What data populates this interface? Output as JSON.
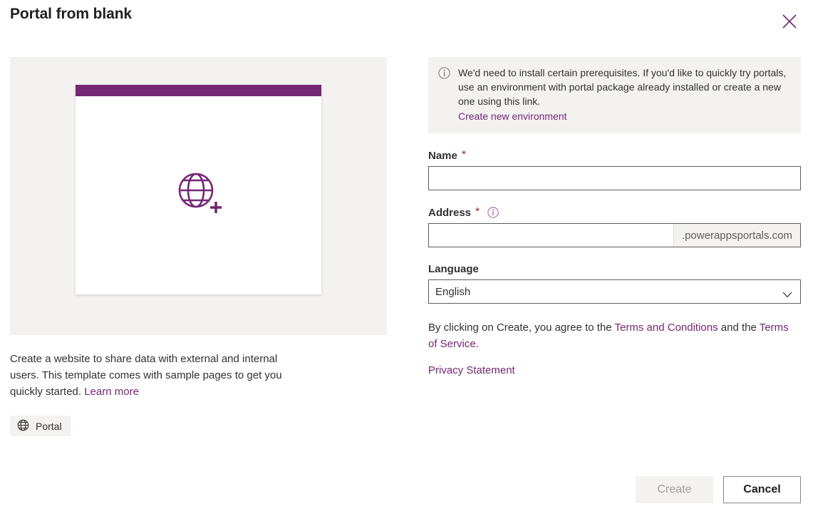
{
  "dialog": {
    "title": "Portal from blank",
    "close_icon": "close-icon"
  },
  "preview": {
    "icon": "globe-plus-icon",
    "accent_color": "#742774",
    "panel_background": "#f3f2f1",
    "description": "Create a website to share data with external and internal users. This template comes with sample pages to get you quickly started.",
    "learn_more_label": "Learn more",
    "tag": {
      "icon": "globe-icon",
      "label": "Portal"
    }
  },
  "banner": {
    "icon": "info-icon",
    "text": "We'd need to install certain prerequisites. If you'd like to quickly try portals, use an environment with portal package already installed or create a new one using this link.",
    "link_label": "Create new environment"
  },
  "form": {
    "name": {
      "label": "Name",
      "required_marker": "*",
      "value": "",
      "placeholder": ""
    },
    "address": {
      "label": "Address",
      "required_marker": "*",
      "info_icon": "info-icon",
      "value": "",
      "placeholder": "",
      "suffix": ".powerappsportals.com"
    },
    "language": {
      "label": "Language",
      "selected": "English",
      "chevron_icon": "chevron-down-icon",
      "options": [
        "English"
      ]
    }
  },
  "legal": {
    "prefix": "By clicking on Create, you agree to the ",
    "terms_and_conditions": "Terms and Conditions",
    "middle": " and the ",
    "terms_of_service": "Terms of Service",
    "suffix": ".",
    "privacy_statement": "Privacy Statement"
  },
  "footer": {
    "create_label": "Create",
    "cancel_label": "Cancel"
  },
  "colors": {
    "accent_purple": "#742774",
    "link_purple": "#742774",
    "required_red": "#a4262c",
    "neutral_light": "#f3f2f1",
    "text_primary": "#323130"
  }
}
